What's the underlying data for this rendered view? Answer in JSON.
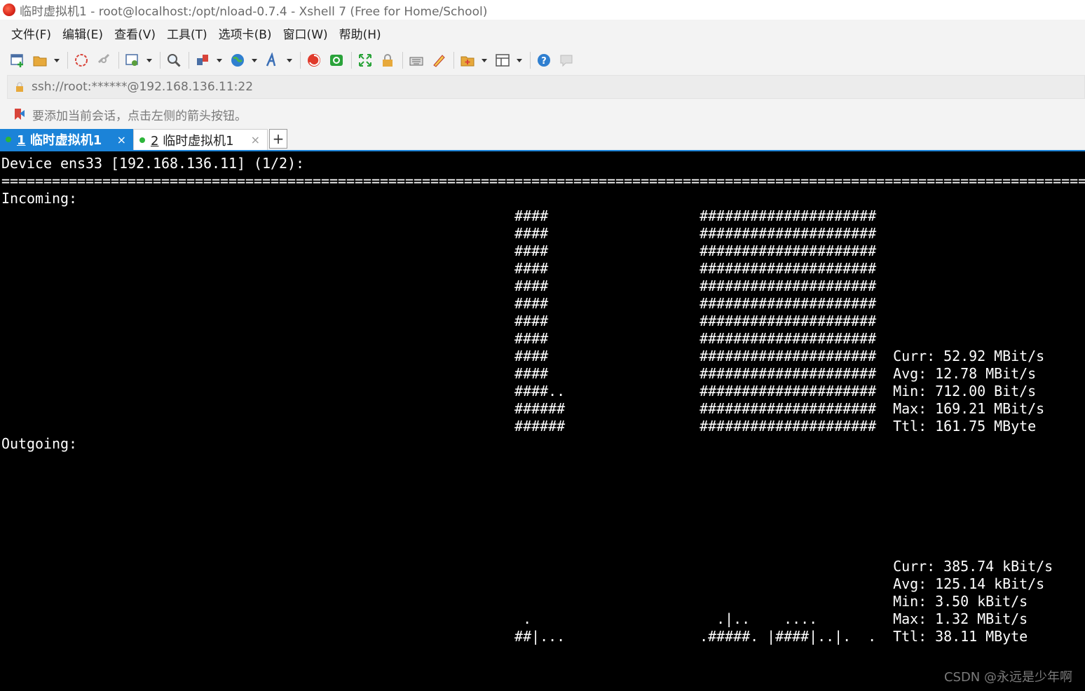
{
  "window": {
    "title": "临时虚拟机1 - root@localhost:/opt/nload-0.7.4 - Xshell 7 (Free for Home/School)"
  },
  "menu": [
    "文件(F)",
    "编辑(E)",
    "查看(V)",
    "工具(T)",
    "选项卡(B)",
    "窗口(W)",
    "帮助(H)"
  ],
  "address": {
    "value": "ssh://root:******@192.168.136.11:22"
  },
  "hint": {
    "text": "要添加当前会话，点击左侧的箭头按钮。"
  },
  "tabs": [
    {
      "num": "1",
      "label": "临时虚拟机1",
      "active": true,
      "close": "×"
    },
    {
      "num": "2",
      "label": "临时虚拟机1",
      "active": false,
      "close": "×"
    }
  ],
  "tab_add": "+",
  "terminal": {
    "lines": [
      "Device ens33 [192.168.136.11] (1/2):",
      "====================================================================================================================================",
      "Incoming:",
      "                                                             ####                  #####################",
      "                                                             ####                  #####################",
      "                                                             ####                  #####################",
      "                                                             ####                  #####################",
      "                                                             ####                  #####################",
      "                                                             ####                  #####################",
      "                                                             ####                  #####################",
      "                                                             ####                  #####################",
      "                                                             ####                  #####################  Curr: 52.92 MBit/s",
      "                                                             ####                  #####################  Avg: 12.78 MBit/s",
      "                                                             ####..                #####################  Min: 712.00 Bit/s",
      "                                                             ######                #####################  Max: 169.21 MBit/s",
      "                                                             ######                #####################  Ttl: 161.75 MByte",
      "Outgoing:",
      "",
      "",
      "",
      "",
      "",
      "",
      "                                                                                                          Curr: 385.74 kBit/s",
      "                                                                                                          Avg: 125.14 kBit/s",
      "                                                                                                          Min: 3.50 kBit/s",
      "                                                              .                      .|..    ....         Max: 1.32 MBit/s",
      "                                                             ##|...                .#####. |####|..|.  .  Ttl: 38.11 MByte"
    ]
  },
  "watermark": "CSDN @永远是少年啊"
}
